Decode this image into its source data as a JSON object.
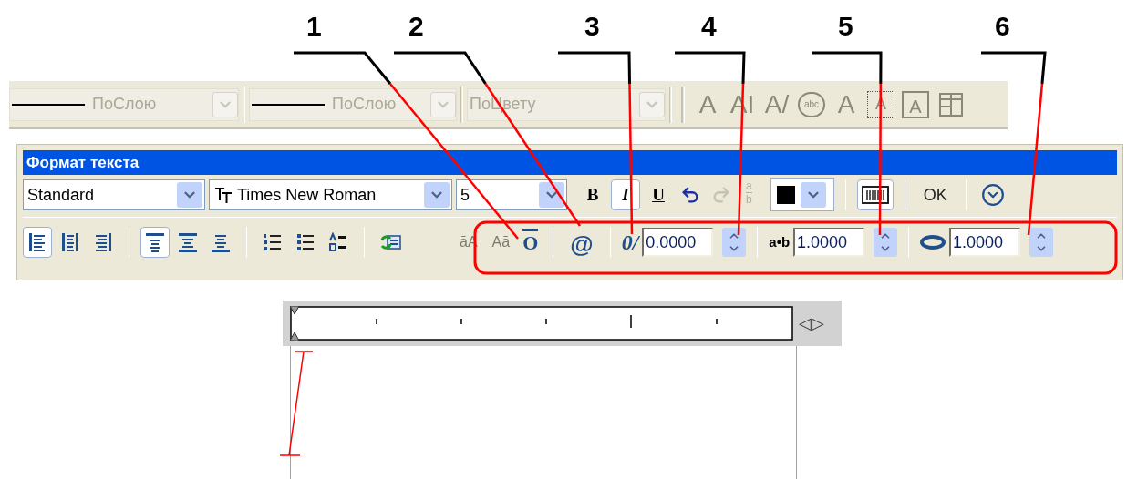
{
  "callouts": [
    {
      "label": "1"
    },
    {
      "label": "2"
    },
    {
      "label": "3"
    },
    {
      "label": "4"
    },
    {
      "label": "5"
    },
    {
      "label": "6"
    }
  ],
  "properties_toolbar": {
    "dropdowns": [
      {
        "value": "ПоСлою",
        "line": true,
        "disabled": true
      },
      {
        "value": "ПоСлою",
        "line": true,
        "disabled": true
      },
      {
        "value": "ПоЦвету",
        "line": false,
        "disabled": true
      }
    ],
    "text_tools": [
      {
        "kind": "glyph",
        "text": "A"
      },
      {
        "kind": "glyph",
        "text": "AI"
      },
      {
        "kind": "glyph",
        "text": "A/"
      },
      {
        "kind": "circle",
        "text": "abc"
      },
      {
        "kind": "glyph",
        "text": "A"
      },
      {
        "kind": "dotted",
        "text": "A"
      },
      {
        "kind": "boxed",
        "text": "A"
      },
      {
        "kind": "table"
      }
    ]
  },
  "text_format": {
    "title": "Формат текста",
    "style": {
      "value": "Standard"
    },
    "font": {
      "value": "Times New Roman"
    },
    "height": {
      "value": "5"
    },
    "bold": {
      "label": "B",
      "selected": false
    },
    "italic": {
      "label": "I",
      "selected": true
    },
    "underline": {
      "label": "U",
      "selected": false
    },
    "undo": {
      "disabled": false
    },
    "redo": {
      "disabled": true
    },
    "stack": {
      "top": "a",
      "bottom": "b",
      "disabled": true
    },
    "text_color": {
      "color": "#000000"
    },
    "ruler": {
      "selected": true
    },
    "ok": "OK",
    "paragraph_tools": [
      [
        {
          "kind": "align-left",
          "selected": true
        },
        {
          "kind": "align-center",
          "selected": false
        },
        {
          "kind": "align-right",
          "selected": false
        }
      ],
      [
        {
          "kind": "valign-top",
          "selected": true
        },
        {
          "kind": "valign-middle",
          "selected": false
        },
        {
          "kind": "valign-bottom",
          "selected": false
        }
      ],
      [
        {
          "kind": "numbered",
          "selected": false
        },
        {
          "kind": "bulleted",
          "selected": false
        },
        {
          "kind": "lettered",
          "selected": false
        }
      ],
      [
        {
          "kind": "insert-field",
          "selected": false
        }
      ]
    ],
    "case_tools": [
      {
        "text": "āA"
      },
      {
        "text": "Aā"
      }
    ],
    "overline": {
      "text": "O"
    },
    "symbol": {
      "text": "@"
    },
    "oblique": {
      "icon": "0/",
      "value": "0.0000"
    },
    "tracking": {
      "icon": "a•b",
      "value": "1.0000"
    },
    "width_factor": {
      "value": "1.0000"
    }
  },
  "editor": {
    "ruler_arrows": "◁▷"
  }
}
